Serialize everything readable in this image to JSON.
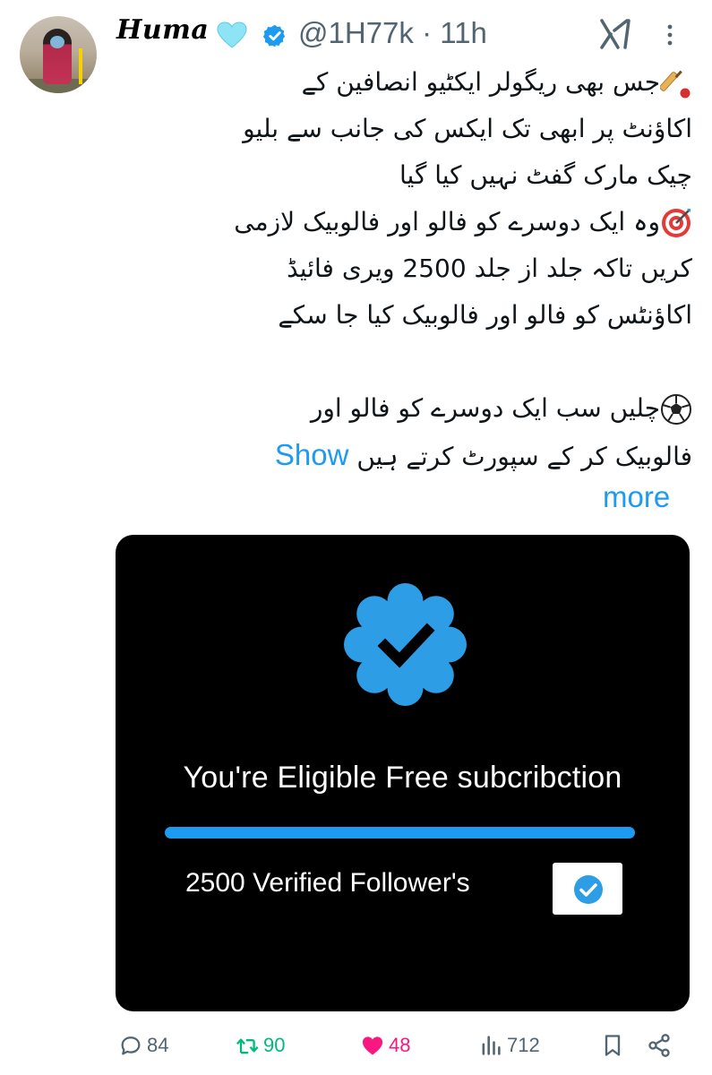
{
  "author": {
    "display_name": "Huma",
    "emoji": "light-blue-heart",
    "verified": true,
    "handle": "@1H77k",
    "separator": "·",
    "time": "11h"
  },
  "tweet": {
    "lines": [
      "جس بھی ریگولر ایکٹیو انصافین کے",
      "اکاؤنٹ پر ابھی تک ایکس کی جانب سے بلیو",
      "چیک مارک گفٹ نہیں کیا گیا",
      "وہ ایک دوسرے کو فالو اور فالوبیک لازمی",
      "کریں تاکہ جلد از جلد 2500 ویری فائیڈ",
      "اکاؤنٹس کو فالو اور فالوبیک کیا جا سکے",
      "",
      "چلیں سب ایک دوسرے کو فالو اور",
      "فالوبیک کر کے سپورٹ کرتے ہیں"
    ],
    "emojis": [
      "cricket-emoji",
      "target-emoji",
      "soccer-ball-emoji"
    ],
    "show_more_label": "Show",
    "more_label": "more"
  },
  "media": {
    "badge_icon": "verified-badge-icon",
    "title": "You're Eligible Free subcribction",
    "progress": 1.0,
    "followers_text": "2500 Verified Follower's",
    "accent": "#1d9bf0"
  },
  "actions": {
    "replies": "84",
    "retweets": "90",
    "likes": "48",
    "views": "712",
    "retweet_color": "#00ba7c",
    "like_color": "#f91880"
  }
}
